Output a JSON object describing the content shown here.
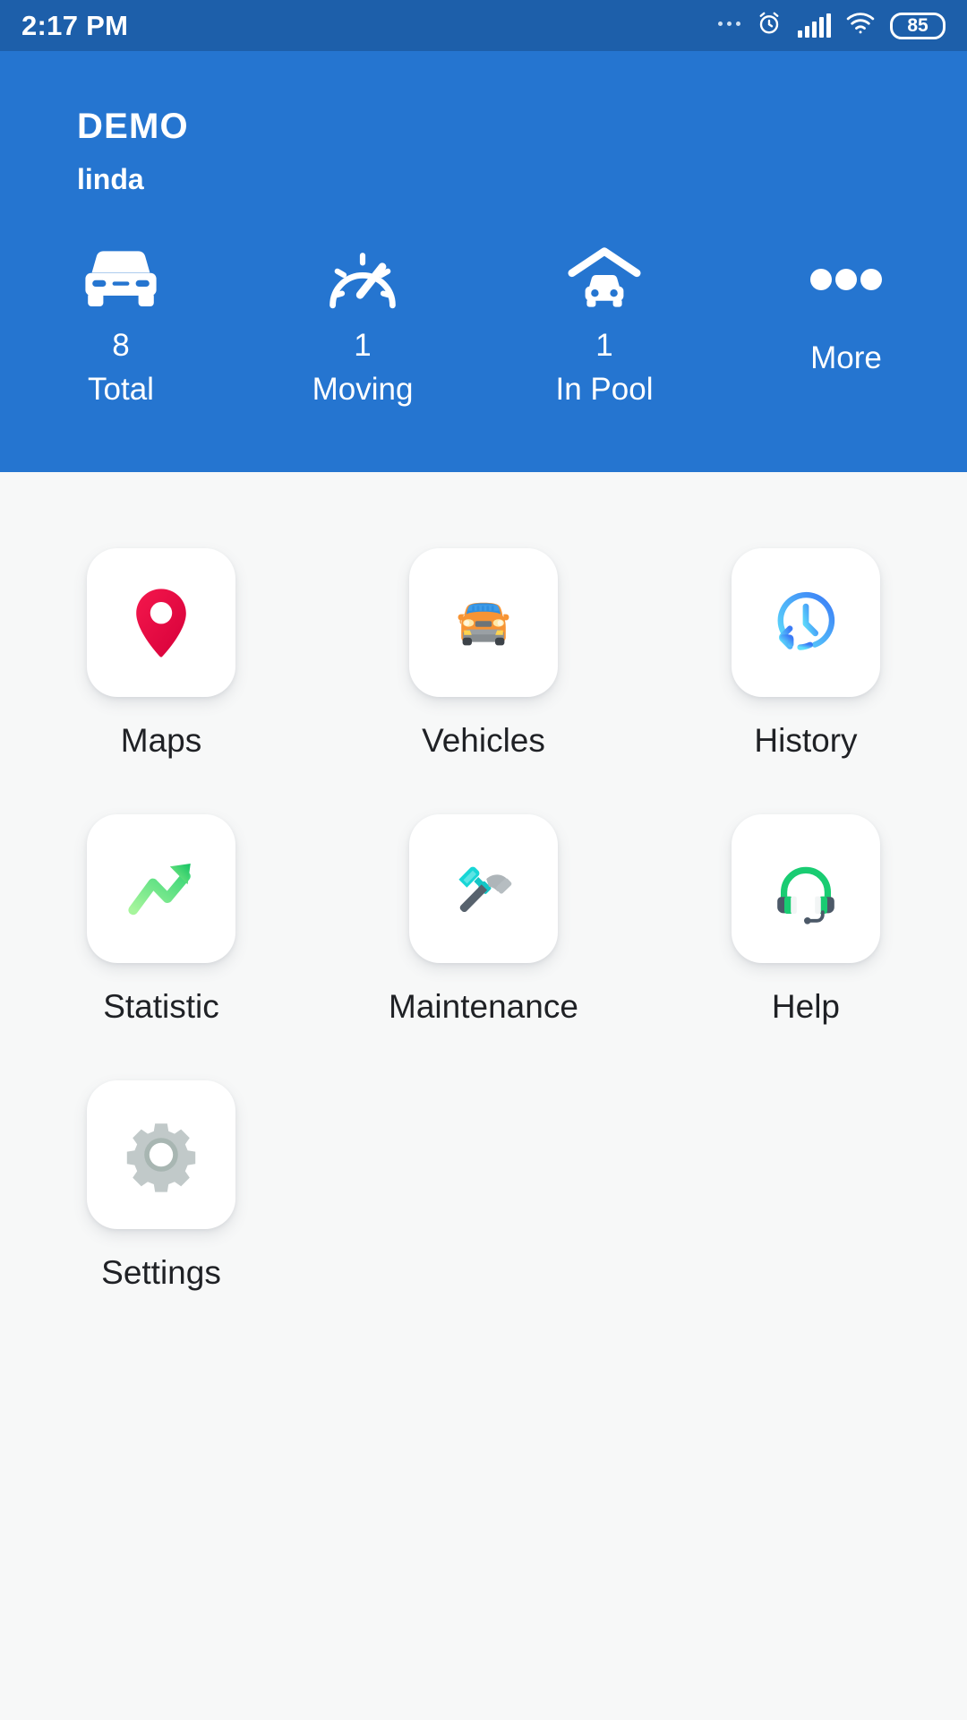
{
  "status_bar": {
    "time": "2:17 PM",
    "battery_level": "85",
    "icons": [
      "ellipsis-icon",
      "alarm-clock-icon",
      "signal-bars-icon",
      "wifi-icon",
      "battery-icon"
    ]
  },
  "header": {
    "title": "DEMO",
    "user": "linda",
    "background_color": "#2575d0",
    "stats": [
      {
        "icon": "car-front-icon",
        "value": "8",
        "label": "Total"
      },
      {
        "icon": "speedometer-icon",
        "value": "1",
        "label": "Moving"
      },
      {
        "icon": "car-garage-icon",
        "value": "1",
        "label": "In Pool"
      },
      {
        "icon": "more-dots-icon",
        "value": "",
        "label": "More"
      }
    ]
  },
  "menu": {
    "items": [
      {
        "label": "Maps",
        "icon": "map-pin-icon",
        "color": "#e8123c"
      },
      {
        "label": "Vehicles",
        "icon": "car-icon",
        "color": "#f79434"
      },
      {
        "label": "History",
        "icon": "clock-back-icon",
        "color": "#3b82f6"
      },
      {
        "label": "Statistic",
        "icon": "trend-up-icon",
        "color": "#2ecc71"
      },
      {
        "label": "Maintenance",
        "icon": "tools-icon",
        "color": "#13c6c6"
      },
      {
        "label": "Help",
        "icon": "headset-icon",
        "color": "#19cc72"
      },
      {
        "label": "Settings",
        "icon": "gear-icon",
        "color": "#b0bbbb"
      }
    ]
  }
}
